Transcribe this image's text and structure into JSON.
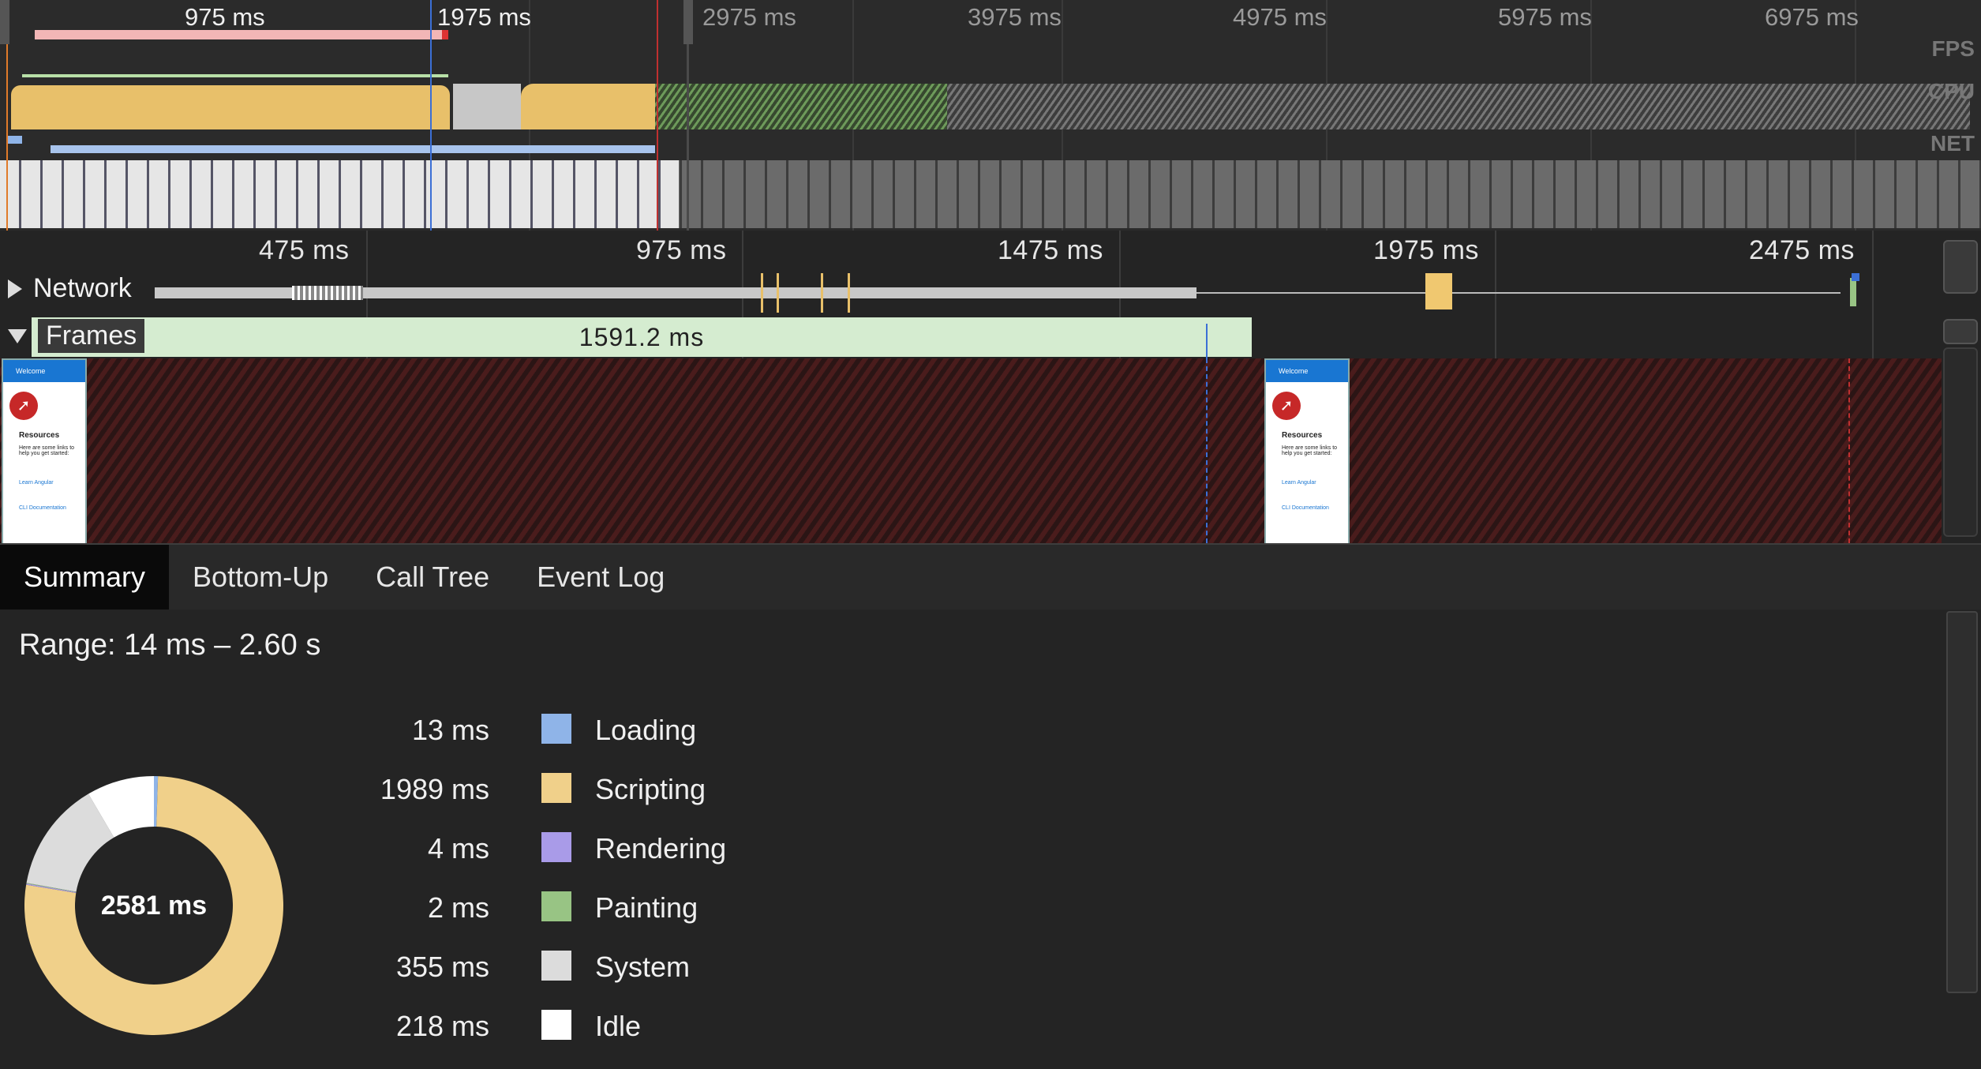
{
  "overview": {
    "tick_labels": [
      "975 ms",
      "1975 ms",
      "2975 ms",
      "3975 ms",
      "4975 ms",
      "5975 ms",
      "6975 ms"
    ],
    "track_labels": {
      "fps": "FPS",
      "cpu": "CPU",
      "net": "NET"
    }
  },
  "timeline": {
    "tick_labels": [
      "475 ms",
      "975 ms",
      "1475 ms",
      "1975 ms",
      "2475 ms"
    ]
  },
  "tracks": {
    "network_label": "Network",
    "frames_label": "Frames",
    "frame_duration": "1591.2 ms"
  },
  "screenshot_thumb": {
    "header": "Welcome",
    "heading": "Resources",
    "text": "Here are some links to help you get started:",
    "link1": "Learn Angular",
    "link2": "CLI Documentation"
  },
  "tabs": [
    "Summary",
    "Bottom-Up",
    "Call Tree",
    "Event Log"
  ],
  "active_tab": "Summary",
  "summary": {
    "range": "Range: 14 ms – 2.60 s",
    "total": "2581 ms",
    "categories": [
      {
        "value": "13 ms",
        "name": "Loading",
        "color": "#8fb4e8",
        "ms": 13
      },
      {
        "value": "1989 ms",
        "name": "Scripting",
        "color": "#f0d08a",
        "ms": 1989
      },
      {
        "value": "4 ms",
        "name": "Rendering",
        "color": "#a99be8",
        "ms": 4
      },
      {
        "value": "2 ms",
        "name": "Painting",
        "color": "#98c484",
        "ms": 2
      },
      {
        "value": "355 ms",
        "name": "System",
        "color": "#dcdcdc",
        "ms": 355
      },
      {
        "value": "218 ms",
        "name": "Idle",
        "color": "#ffffff",
        "ms": 218
      }
    ]
  }
}
